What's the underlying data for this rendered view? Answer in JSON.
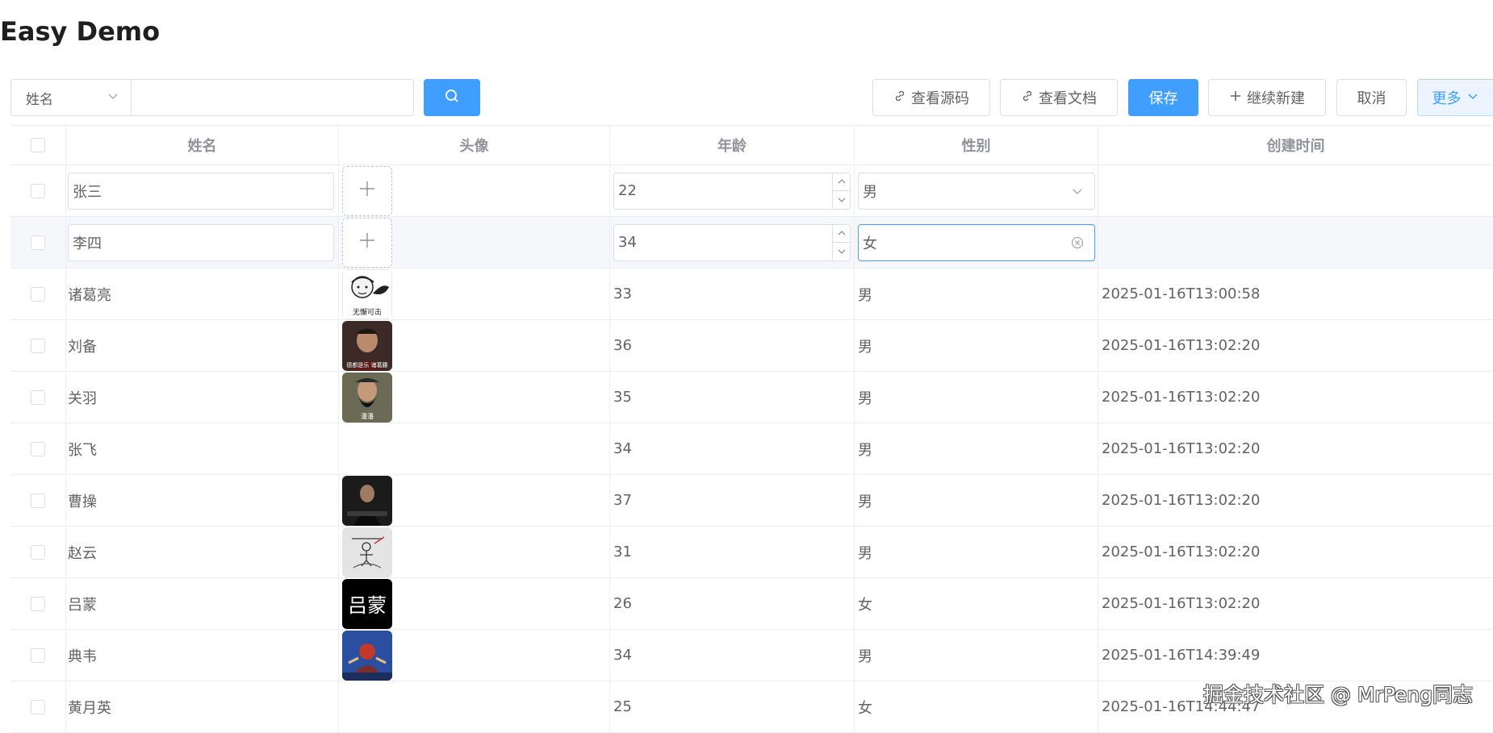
{
  "title": "Easy Demo",
  "toolbar": {
    "field_select": "姓名",
    "search_value": "",
    "view_source": "查看源码",
    "view_docs": "查看文档",
    "save": "保存",
    "continue_new": "继续新建",
    "cancel": "取消",
    "more": "更多"
  },
  "colors": {
    "primary": "#409eff",
    "border": "#dcdfe6",
    "header_text": "#909399",
    "text": "#606266"
  },
  "table": {
    "headers": [
      "姓名",
      "头像",
      "年龄",
      "性别",
      "创建时间"
    ],
    "edit_rows": [
      {
        "name": "张三",
        "age": "22",
        "gender": "男"
      },
      {
        "name": "李四",
        "age": "34",
        "gender": "女"
      }
    ],
    "rows": [
      {
        "name": "诸葛亮",
        "avatar": "meme-avatar",
        "avatar_text": "无懈可击",
        "age": "33",
        "gender": "男",
        "created": "2025-01-16T13:00:58"
      },
      {
        "name": "刘备",
        "avatar": "portrait-avatar",
        "avatar_text": "德都是乐 诸葛腰",
        "age": "36",
        "gender": "男",
        "created": "2025-01-16T13:02:20"
      },
      {
        "name": "关羽",
        "avatar": "portrait-avatar",
        "avatar_text": "潘潘",
        "age": "35",
        "gender": "男",
        "created": "2025-01-16T13:02:20"
      },
      {
        "name": "张飞",
        "avatar": "",
        "age": "34",
        "gender": "男",
        "created": "2025-01-16T13:02:20"
      },
      {
        "name": "曹操",
        "avatar": "portrait-avatar",
        "age": "37",
        "gender": "男",
        "created": "2025-01-16T13:02:20"
      },
      {
        "name": "赵云",
        "avatar": "sketch-avatar",
        "age": "31",
        "gender": "男",
        "created": "2025-01-16T13:02:20"
      },
      {
        "name": "吕蒙",
        "avatar": "text-avatar",
        "avatar_text": "吕蒙",
        "age": "26",
        "gender": "女",
        "created": "2025-01-16T13:02:20"
      },
      {
        "name": "典韦",
        "avatar": "game-avatar",
        "age": "34",
        "gender": "男",
        "created": "2025-01-16T14:39:49"
      },
      {
        "name": "黄月英",
        "avatar": "",
        "age": "25",
        "gender": "女",
        "created": "2025-01-16T14:44:47"
      }
    ]
  },
  "watermark": "掘金技术社区 @ MrPeng同志"
}
